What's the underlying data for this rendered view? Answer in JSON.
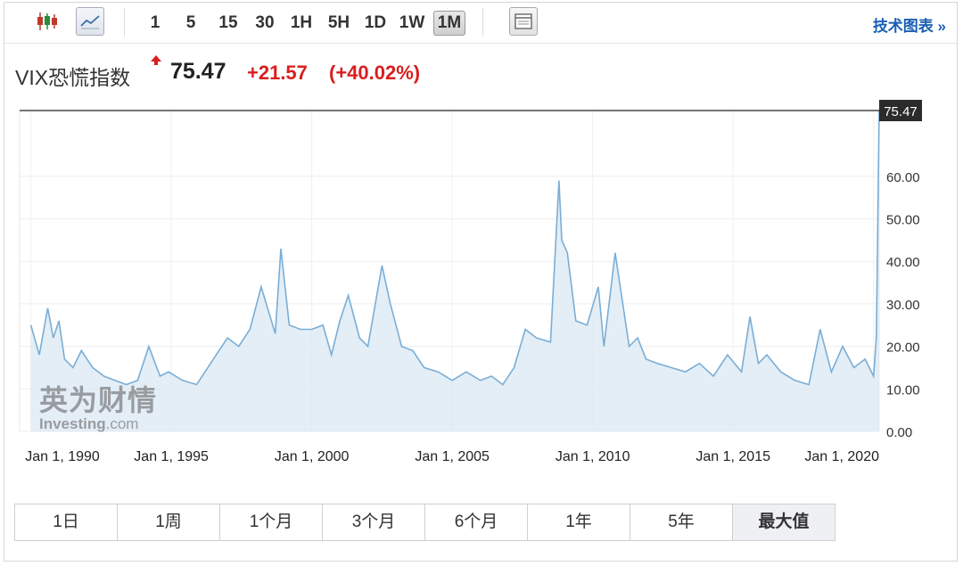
{
  "toolbar": {
    "timeframes": [
      "1",
      "5",
      "15",
      "30",
      "1H",
      "5H",
      "1D",
      "1W",
      "1M"
    ],
    "active_timeframe": "1M",
    "tech_chart_link": "技术图表 »"
  },
  "header": {
    "title": "VIX恐慌指数",
    "price": "75.47",
    "change": "+21.57",
    "change_pct": "(+40.02%)",
    "up_color": "#d91e1e"
  },
  "watermark": {
    "cn": "英为财情",
    "en": "Investing",
    "en_suffix": ".com"
  },
  "periods": [
    "1日",
    "1周",
    "1个月",
    "3个月",
    "6个月",
    "1年",
    "5年",
    "最大值"
  ],
  "active_period": "最大值",
  "chart_data": {
    "type": "area",
    "title": "",
    "xlabel": "",
    "ylabel": "",
    "x_ticks": [
      "Jan 1, 1990",
      "Jan 1, 1995",
      "Jan 1, 2000",
      "Jan 1, 2005",
      "Jan 1, 2010",
      "Jan 1, 2015",
      "Jan 1, 2020"
    ],
    "y_ticks": [
      "0.00",
      "10.00",
      "20.00",
      "30.00",
      "40.00",
      "50.00",
      "60.00"
    ],
    "ylim": [
      0,
      75.47
    ],
    "last_value_label": "75.47",
    "last_value": 75.47,
    "grid": true,
    "line_color": "#7aaed6",
    "fill_color": "#dbe8f3",
    "series": [
      {
        "x": [
          1990.0,
          1990.3,
          1990.6,
          1990.8,
          1991.0,
          1991.2,
          1991.5,
          1991.8,
          1992.2,
          1992.6,
          1993.0,
          1993.4,
          1993.8,
          1994.2,
          1994.6,
          1994.9,
          1995.4,
          1995.9,
          1996.3,
          1996.6,
          1997.0,
          1997.4,
          1997.8,
          1998.2,
          1998.7,
          1998.9,
          1999.2,
          1999.6,
          2000.0,
          2000.4,
          2000.7,
          2001.0,
          2001.3,
          2001.7,
          2002.0,
          2002.5,
          2002.8,
          2003.2,
          2003.6,
          2004.0,
          2004.5,
          2005.0,
          2005.5,
          2006.0,
          2006.4,
          2006.8,
          2007.2,
          2007.6,
          2008.0,
          2008.5,
          2008.8,
          2008.9,
          2009.1,
          2009.4,
          2009.8,
          2010.2,
          2010.4,
          2010.8,
          2011.3,
          2011.6,
          2011.9,
          2012.3,
          2012.8,
          2013.3,
          2013.8,
          2014.3,
          2014.8,
          2015.3,
          2015.6,
          2015.9,
          2016.2,
          2016.7,
          2017.2,
          2017.7,
          2018.1,
          2018.5,
          2018.9,
          2019.3,
          2019.7,
          2020.0,
          2020.1,
          2020.2
        ],
        "y": [
          25,
          18,
          29,
          22,
          26,
          17,
          15,
          19,
          15,
          13,
          12,
          11,
          12,
          20,
          13,
          14,
          12,
          11,
          15,
          18,
          22,
          20,
          24,
          34,
          23,
          43,
          25,
          24,
          24,
          25,
          18,
          26,
          32,
          22,
          20,
          39,
          30,
          20,
          19,
          15,
          14,
          12,
          14,
          12,
          13,
          11,
          15,
          24,
          22,
          21,
          59,
          45,
          42,
          26,
          25,
          34,
          20,
          42,
          20,
          22,
          17,
          16,
          15,
          14,
          16,
          13,
          18,
          14,
          27,
          16,
          18,
          14,
          12,
          11,
          24,
          14,
          20,
          15,
          17,
          13,
          22,
          75.47
        ]
      }
    ]
  }
}
